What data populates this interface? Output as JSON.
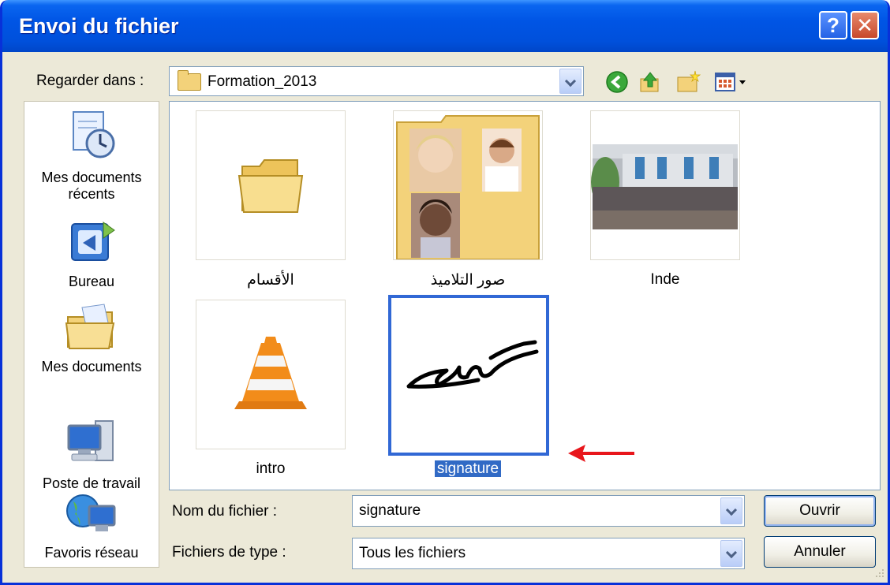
{
  "window": {
    "title": "Envoi du fichier"
  },
  "titlebar": {
    "help_label": "?",
    "close_label": "✕"
  },
  "lookin": {
    "label": "Regarder dans :",
    "value": "Formation_2013"
  },
  "toolbar": {
    "icons": [
      "back-icon",
      "up-folder-icon",
      "new-folder-icon",
      "views-menu-icon"
    ]
  },
  "places": [
    {
      "label": "Mes documents récents",
      "icon": "recent-documents-icon"
    },
    {
      "label": "Bureau",
      "icon": "desktop-icon"
    },
    {
      "label": "Mes documents",
      "icon": "my-documents-icon"
    },
    {
      "label": "Poste de travail",
      "icon": "my-computer-icon"
    },
    {
      "label": "Favoris réseau",
      "icon": "network-places-icon"
    }
  ],
  "files": [
    {
      "name": "الأقسام",
      "type": "folder"
    },
    {
      "name": "صور التلاميذ",
      "type": "folder-with-photos"
    },
    {
      "name": "Inde",
      "type": "image"
    },
    {
      "name": "intro",
      "type": "video"
    },
    {
      "name": "signature",
      "type": "image",
      "selected": true
    }
  ],
  "filename": {
    "label": "Nom du fichier :",
    "value": "signature"
  },
  "filetype": {
    "label": "Fichiers de type :",
    "value": "Tous les fichiers"
  },
  "buttons": {
    "open": "Ouvrir",
    "cancel": "Annuler"
  },
  "colors": {
    "title_bar": "#0055E5",
    "selection": "#316AC5",
    "annotation_arrow": "#E8161C"
  }
}
